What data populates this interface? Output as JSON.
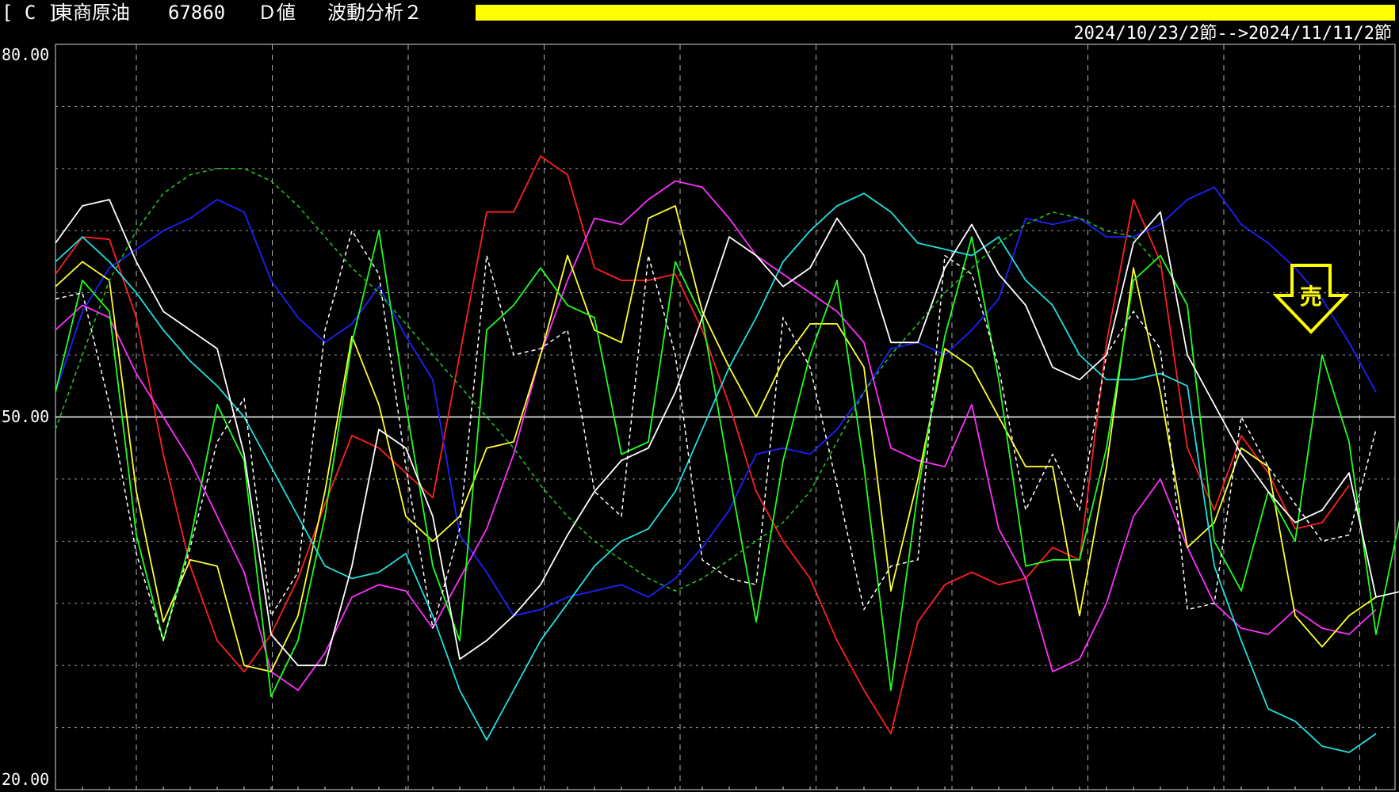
{
  "header": {
    "bracket_code": "[ C ]",
    "instrument": "東商原油",
    "code": "67860",
    "value_type": "Ｄ値",
    "analysis": "波動分析２"
  },
  "date_range": "2024/10/23/2節-->2024/11/11/2節",
  "signal": {
    "label": "売",
    "color": "#ffff00"
  },
  "colors": {
    "background": "#000000",
    "grid": "#bbbbbb",
    "accent_bar": "#ffff00"
  },
  "chart_data": {
    "type": "line",
    "ylim": [
      20,
      80
    ],
    "y_ticks": [
      "80.00",
      "50.00",
      "20.00"
    ],
    "reference_line": 50,
    "grid": true,
    "series": [
      {
        "color": "#ff2020",
        "style": "solid",
        "values": [
          61.5,
          64.5,
          64.3,
          58,
          47,
          38,
          32,
          29.5,
          32.5,
          37,
          43,
          48.5,
          47.5,
          45.5,
          43.5,
          55,
          66.5,
          66.5,
          71,
          69.5,
          62,
          61,
          61,
          61.5,
          57,
          51,
          44,
          40,
          37,
          32,
          28,
          24.5,
          33.5,
          36.5,
          37.5,
          36.5,
          37,
          39.5,
          38.5,
          56,
          67.5,
          62.5,
          47.5,
          42.5,
          48.5,
          45.5,
          41,
          41.5,
          44.5
        ]
      },
      {
        "color": "#2020ff",
        "style": "solid",
        "values": [
          52,
          58.5,
          62,
          63.5,
          65,
          66,
          67.5,
          66.5,
          61,
          58,
          56,
          57.5,
          60.5,
          56.5,
          53,
          40.5,
          37.5,
          34,
          34.5,
          35.5,
          36,
          36.5,
          35.5,
          37,
          39.5,
          42.5,
          47,
          47.5,
          47,
          49,
          52,
          55.5,
          56,
          55,
          57,
          59.5,
          66,
          65.5,
          66,
          64.5,
          64.5,
          65.5,
          67.5,
          68.5,
          65.5,
          64,
          62,
          59.5,
          56,
          52
        ]
      },
      {
        "color": "#ff30ff",
        "style": "solid",
        "values": [
          57,
          59,
          58,
          53.5,
          50,
          46.5,
          42,
          37.5,
          29.5,
          28,
          31,
          35.5,
          36.5,
          36,
          33,
          37,
          41,
          47,
          55,
          61,
          66,
          65.5,
          67.5,
          69,
          68.5,
          66,
          63,
          61.5,
          60,
          58.5,
          56,
          47.5,
          46.5,
          46,
          51,
          41,
          37,
          29.5,
          30.5,
          35,
          42,
          45,
          39.5,
          35,
          33,
          32.5,
          34.5,
          33,
          32.5,
          34.5
        ]
      },
      {
        "color": "#ffff30",
        "style": "solid",
        "values": [
          60.5,
          62.5,
          61,
          44,
          33.5,
          38.5,
          38,
          30,
          29.5,
          34,
          44,
          56.5,
          51,
          42,
          40,
          42,
          47.5,
          48,
          55,
          63,
          57,
          56,
          66,
          67,
          58.5,
          54,
          50,
          54.5,
          57.5,
          57.5,
          54,
          36,
          45,
          55.5,
          54,
          50,
          46,
          46,
          34,
          46,
          62,
          52,
          39.5,
          41.5,
          47.5,
          46,
          34,
          31.5,
          34,
          35.5
        ]
      },
      {
        "color": "#20ff20",
        "style": "solid",
        "values": [
          52,
          61,
          58.5,
          40.5,
          32,
          40,
          51,
          46.5,
          27.5,
          32,
          42,
          56,
          65,
          51,
          38,
          32,
          57,
          59,
          62,
          59,
          58,
          47,
          48,
          62.5,
          58,
          45.5,
          33.5,
          46.5,
          55,
          61,
          46,
          28,
          44,
          56.5,
          64.5,
          53,
          38,
          38.5,
          38.5,
          47.5,
          61,
          63,
          59,
          40,
          36,
          44,
          40,
          55,
          48,
          32.5,
          43
        ]
      },
      {
        "color": "#20e0e0",
        "style": "solid",
        "values": [
          62.5,
          64.5,
          62.5,
          60,
          57,
          54.5,
          52.5,
          50,
          46,
          42,
          38,
          37,
          37.5,
          39,
          34,
          28,
          24,
          28,
          32,
          35,
          38,
          40,
          41,
          44,
          49,
          54,
          58,
          62.5,
          65,
          67,
          68,
          66.5,
          64,
          63.5,
          63,
          64.5,
          61,
          59,
          55,
          53,
          53,
          53.5,
          52.5,
          38,
          32,
          26.5,
          25.5,
          23.5,
          23,
          24.5
        ]
      },
      {
        "color": "#ffffff",
        "style": "solid",
        "values": [
          64,
          67,
          67.5,
          62.5,
          58.5,
          57,
          55.5,
          47,
          32.5,
          30,
          30,
          38,
          49,
          47.5,
          42,
          30.5,
          32,
          34,
          36.5,
          40.5,
          44,
          46.5,
          47.5,
          52,
          58,
          64.5,
          63,
          60.5,
          62,
          66,
          63,
          56,
          56,
          62,
          65.5,
          61.5,
          59,
          54,
          53,
          55,
          64,
          66.5,
          55,
          51,
          47,
          44,
          41.5,
          42.5,
          45.5,
          35.5,
          36
        ]
      },
      {
        "color": "#ffffff",
        "style": "dashed",
        "values": [
          59.5,
          60,
          51,
          39,
          32,
          39.5,
          48,
          51.5,
          34,
          37.5,
          57,
          65,
          61.5,
          46,
          33,
          41,
          63,
          55,
          55.5,
          57,
          44,
          42,
          63,
          55,
          38.5,
          37,
          36.5,
          58,
          54,
          44.5,
          34.5,
          38,
          38.5,
          63,
          61.5,
          54,
          42.5,
          47,
          42.5,
          55,
          58.5,
          55.5,
          34.5,
          35,
          50,
          46,
          43,
          40,
          40.5,
          49
        ]
      },
      {
        "color": "#20cc20",
        "style": "dashed",
        "values": [
          49,
          55,
          61,
          65,
          68,
          69.5,
          70,
          70,
          69,
          67,
          64.5,
          62,
          60,
          57.5,
          55,
          52.5,
          50,
          47.5,
          44.5,
          42,
          40,
          38.5,
          37,
          36,
          37,
          38.5,
          40,
          41.5,
          44,
          48,
          52,
          55,
          57.5,
          60,
          62,
          64,
          65.5,
          66.5,
          66,
          65,
          64.5,
          62
        ]
      }
    ]
  }
}
